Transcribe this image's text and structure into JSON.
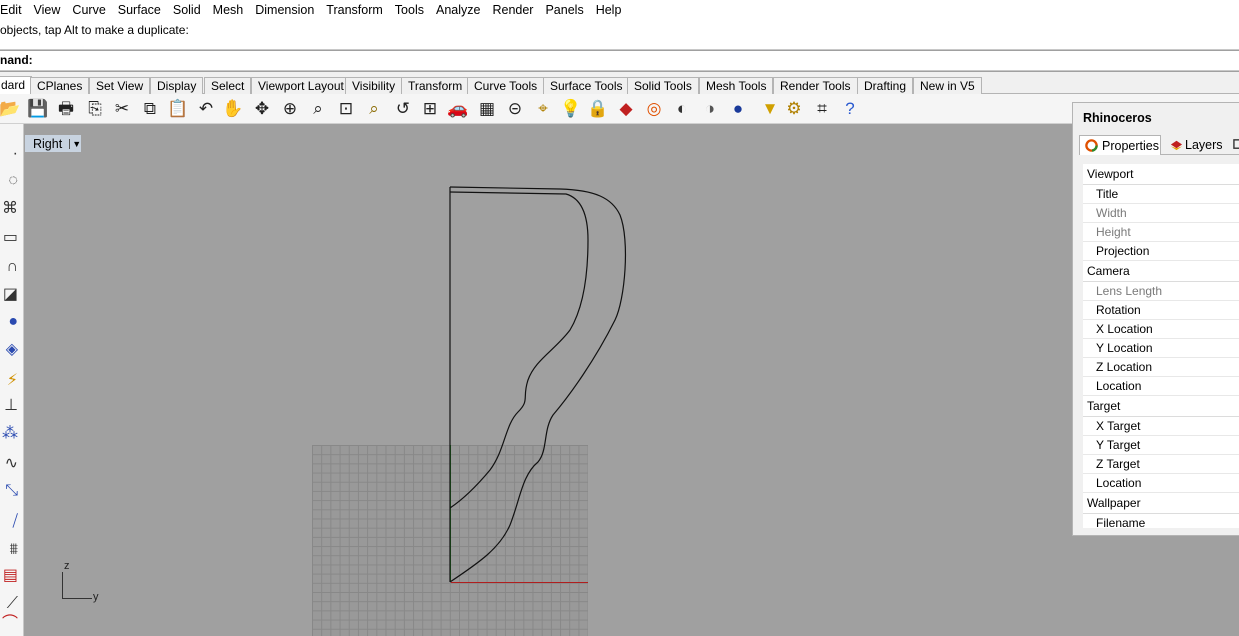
{
  "menu": {
    "items": [
      "Edit",
      "View",
      "Curve",
      "Surface",
      "Solid",
      "Mesh",
      "Dimension",
      "Transform",
      "Tools",
      "Analyze",
      "Render",
      "Panels",
      "Help"
    ]
  },
  "command": {
    "history_line": "objects, tap Alt to make a duplicate:",
    "prompt_label": "nand:"
  },
  "toolbar_tabs": [
    "dard",
    "CPlanes",
    "Set View",
    "Display",
    "Select",
    "Viewport Layout",
    "Visibility",
    "Transform",
    "Curve Tools",
    "Surface Tools",
    "Solid Tools",
    "Mesh Tools",
    "Render Tools",
    "Drafting",
    "New in V5"
  ],
  "toolbar_icons": [
    "open-icon",
    "save-icon",
    "print-icon",
    "import-icon",
    "cut-icon",
    "copy-icon",
    "paste-icon",
    "undo-icon",
    "pan-icon",
    "rotate-view-icon",
    "zoom-icon",
    "zoom-window-icon",
    "zoom-extents-icon",
    "zoom-selected-icon",
    "undo-view-icon",
    "four-viewports-icon",
    "car-icon",
    "grid-icon",
    "cplane-icon",
    "osnap-icon",
    "light-icon",
    "lock-icon",
    "layer-icon",
    "color-icon",
    "shade-icon",
    "rendered-icon",
    "sphere-icon",
    "select-filter-icon",
    "options-icon",
    "dimension-icon",
    "help-icon"
  ],
  "left_tool_icons": [
    "point-icon",
    "circle-icon",
    "polyline-icon",
    "rectangle-icon",
    "arc-icon",
    "surface-icon",
    "solid-sphere-icon",
    "patch-icon",
    "boolean-icon",
    "dimension-tool-icon",
    "points-icon",
    "edit-curve-icon",
    "transform-icon",
    "measure-icon",
    "array-icon",
    "block-icon",
    "line-icon",
    "curve-tool-icon"
  ],
  "viewport": {
    "name": "Right",
    "axis_z": "z",
    "axis_y": "y"
  },
  "panel": {
    "title": "Rhinoceros",
    "tabs": [
      "Properties",
      "Layers"
    ],
    "sections": [
      {
        "name": "Viewport",
        "fields": [
          {
            "label": "Title",
            "disabled": false
          },
          {
            "label": "Width",
            "disabled": true
          },
          {
            "label": "Height",
            "disabled": true
          },
          {
            "label": "Projection",
            "disabled": false
          }
        ]
      },
      {
        "name": "Camera",
        "fields": [
          {
            "label": "Lens Length",
            "disabled": true
          },
          {
            "label": "Rotation",
            "disabled": false
          },
          {
            "label": "X Location",
            "disabled": false
          },
          {
            "label": "Y Location",
            "disabled": false
          },
          {
            "label": "Z Location",
            "disabled": false
          },
          {
            "label": "Location",
            "disabled": false
          }
        ]
      },
      {
        "name": "Target",
        "fields": [
          {
            "label": "X Target",
            "disabled": false
          },
          {
            "label": "Y Target",
            "disabled": false
          },
          {
            "label": "Z Target",
            "disabled": false
          },
          {
            "label": "Location",
            "disabled": false
          }
        ]
      },
      {
        "name": "Wallpaper",
        "fields": [
          {
            "label": "Filename",
            "disabled": false
          }
        ]
      }
    ]
  }
}
